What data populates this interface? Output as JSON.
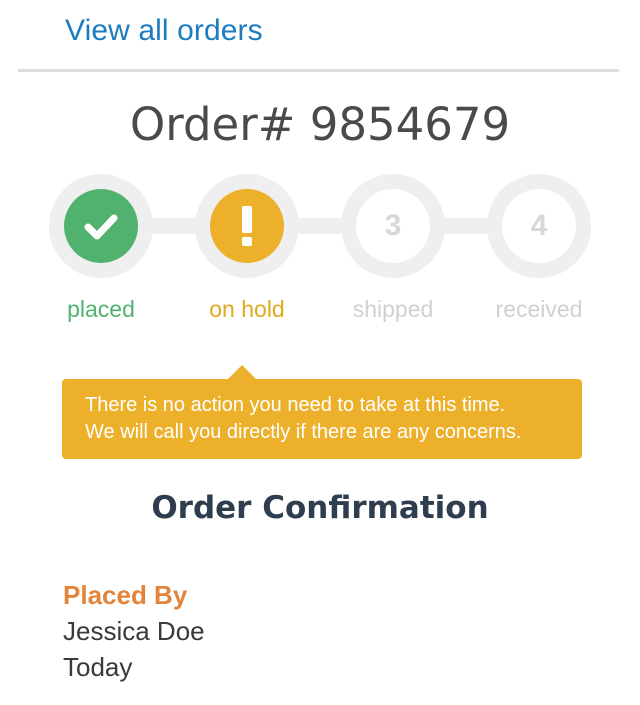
{
  "nav": {
    "view_all_orders": "View all orders"
  },
  "order": {
    "title": "Order# 9854679"
  },
  "tracker": {
    "current_step": 2,
    "steps": [
      {
        "label": "placed",
        "status": "complete",
        "icon": "check-icon",
        "color": "#51b26f"
      },
      {
        "label": "on hold",
        "status": "warning",
        "icon": "exclamation-icon",
        "color": "#ecb02a"
      },
      {
        "label": "shipped",
        "status": "pending",
        "number": "3",
        "color": "#d0d0d0"
      },
      {
        "label": "received",
        "status": "pending",
        "number": "4",
        "color": "#d0d0d0"
      }
    ]
  },
  "notice": {
    "line1": "There is no action you need to take at this time.",
    "line2": "We will call you directly if there are any concerns."
  },
  "confirmation": {
    "title": "Order Confirmation",
    "placed_by_label": "Placed By",
    "placed_by_name": "Jessica Doe",
    "placed_date": "Today"
  },
  "colors": {
    "link": "#1d7cbf",
    "success": "#51b26f",
    "warning": "#ecb02a",
    "accent_orange": "#e3843b",
    "inactive": "#d0d0d0"
  }
}
